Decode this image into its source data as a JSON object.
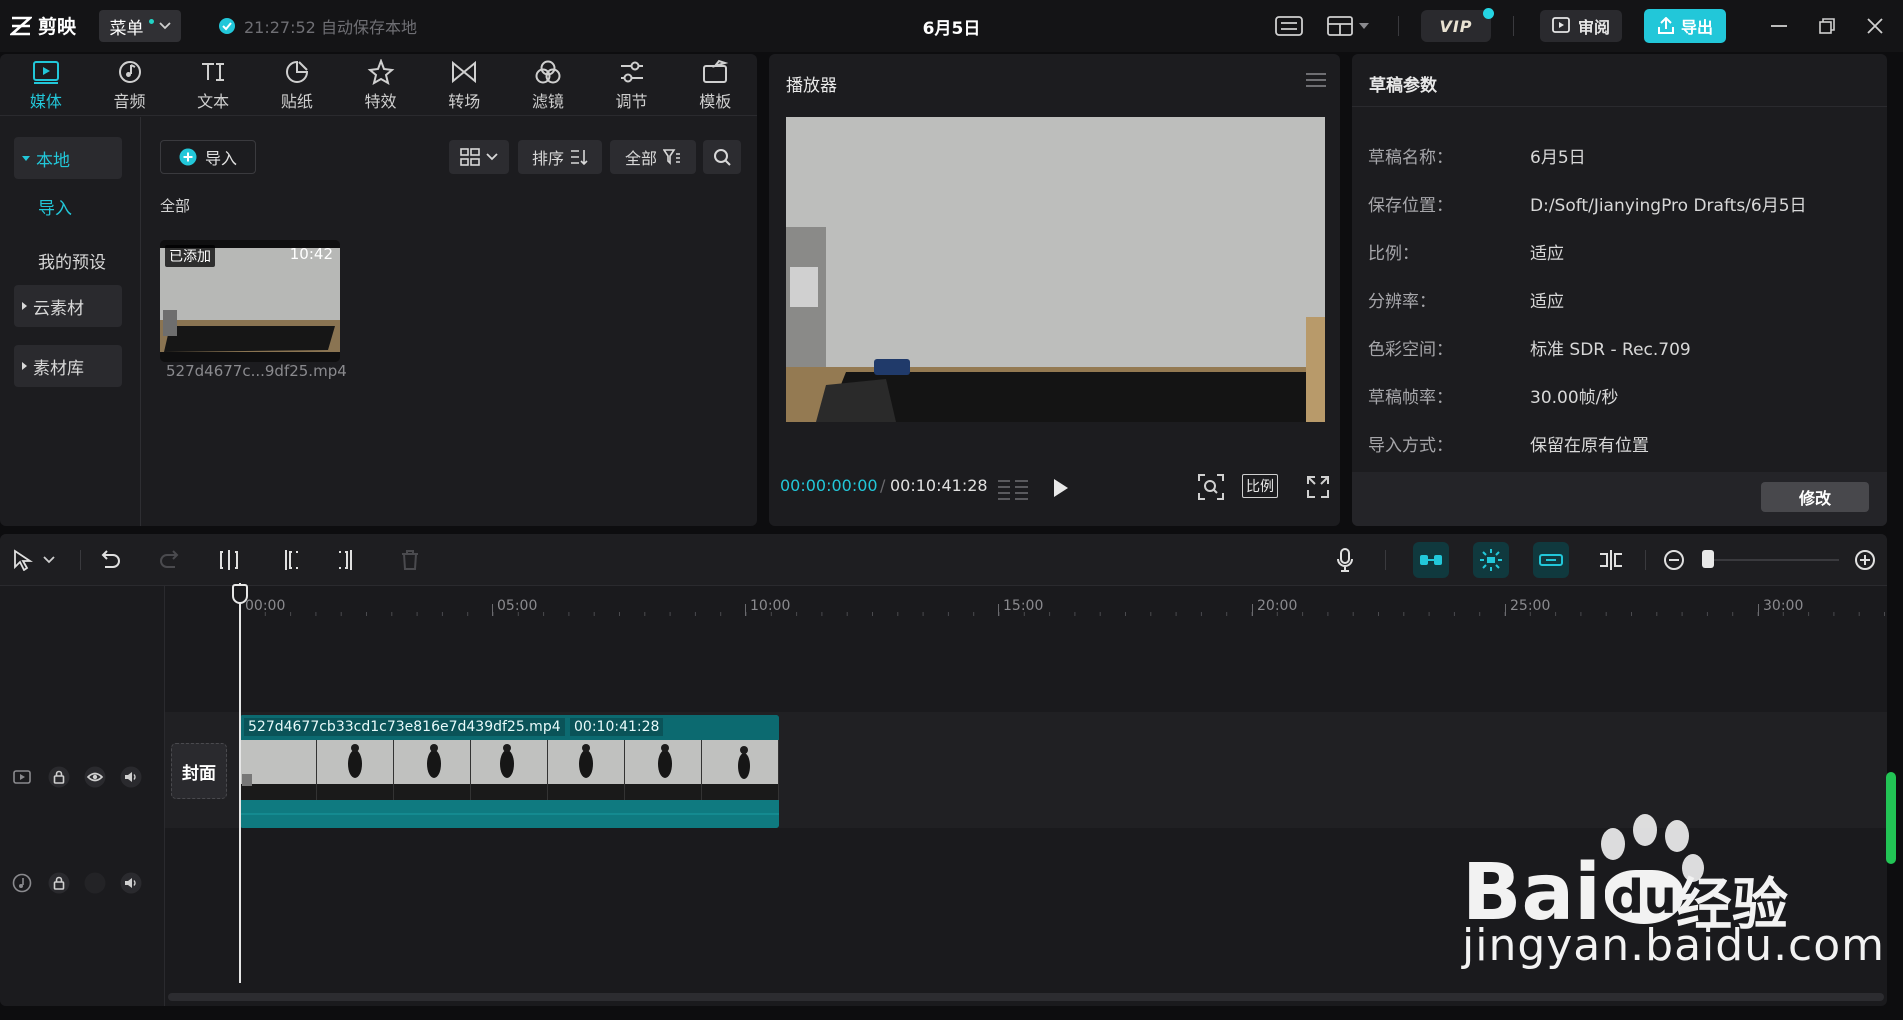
{
  "app": {
    "logo": "剪映",
    "menu_label": "菜单",
    "autosave": "21:27:52 自动保存本地",
    "doc_title": "6月5日"
  },
  "titlebar": {
    "vip_label": "VIP",
    "review_label": "审阅",
    "export_label": "导出"
  },
  "tool_tabs": [
    {
      "label": "媒体",
      "icon": "media-icon"
    },
    {
      "label": "音频",
      "icon": "audio-icon"
    },
    {
      "label": "文本",
      "icon": "text-icon"
    },
    {
      "label": "贴纸",
      "icon": "sticker-icon"
    },
    {
      "label": "特效",
      "icon": "effects-icon"
    },
    {
      "label": "转场",
      "icon": "transition-icon"
    },
    {
      "label": "滤镜",
      "icon": "filter-icon"
    },
    {
      "label": "调节",
      "icon": "adjust-icon"
    },
    {
      "label": "模板",
      "icon": "template-icon"
    }
  ],
  "media_nav": {
    "local": "本地",
    "import": "导入",
    "presets": "我的预设",
    "cloud": "云素材",
    "library": "素材库"
  },
  "media": {
    "import_label": "导入",
    "sort_label": "排序",
    "filter_label": "全部",
    "section": "全部",
    "item": {
      "added": "已添加",
      "duration": "10:42",
      "name": "527d4677c...9df25.mp4"
    }
  },
  "player": {
    "title": "播放器",
    "current": "00:00:00:00",
    "sep": "/",
    "total": "00:10:41:28",
    "ratio_label": "比例"
  },
  "draft": {
    "title": "草稿参数",
    "rows": [
      {
        "k": "草稿名称：",
        "v": "6月5日"
      },
      {
        "k": "保存位置：",
        "v": "D:/Soft/JianyingPro Drafts/6月5日"
      },
      {
        "k": "比例：",
        "v": "适应"
      },
      {
        "k": "分辨率：",
        "v": "适应"
      },
      {
        "k": "色彩空间：",
        "v": "标准 SDR - Rec.709"
      },
      {
        "k": "草稿帧率：",
        "v": "30.00帧/秒"
      },
      {
        "k": "导入方式：",
        "v": "保留在原有位置"
      }
    ],
    "modify_label": "修改"
  },
  "timeline": {
    "ruler": [
      "00:00",
      "05:00",
      "10:00",
      "15:00",
      "20:00",
      "25:00",
      "30:00"
    ],
    "cover_label": "封面",
    "clip_name": "527d4677cb33cd1c73e816e7d439df25.mp4",
    "clip_duration": "00:10:41:28"
  },
  "watermark": {
    "brand": "Bai",
    "brand_du": "du",
    "brand_cn": "经验",
    "url": "jingyan.baidu.com"
  },
  "colors": {
    "accent": "#22c7d9",
    "bg": "#0d0d0f",
    "panel": "#1c1c1f",
    "clip": "#0c6a70"
  }
}
